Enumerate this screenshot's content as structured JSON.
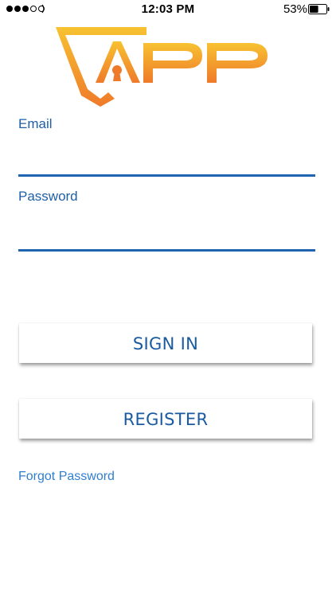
{
  "status_bar": {
    "time": "12:03 PM",
    "battery_percent": "53%",
    "battery_level": 0.53,
    "signal_bars_filled": 3,
    "signal_bars_total": 5
  },
  "logo": {
    "text": "APP",
    "colors": {
      "top": "#f7c231",
      "bottom": "#ef7a2a"
    }
  },
  "form": {
    "email": {
      "label": "Email",
      "value": "",
      "placeholder": ""
    },
    "password": {
      "label": "Password",
      "value": "",
      "placeholder": ""
    }
  },
  "buttons": {
    "signin_label": "SIGN IN",
    "register_label": "REGISTER"
  },
  "links": {
    "forgot_password": "Forgot Password"
  },
  "colors": {
    "accent": "#1f64b0",
    "label": "#1f5fa8",
    "link": "#2f7fd0",
    "button_text": "#1a5aa0"
  }
}
